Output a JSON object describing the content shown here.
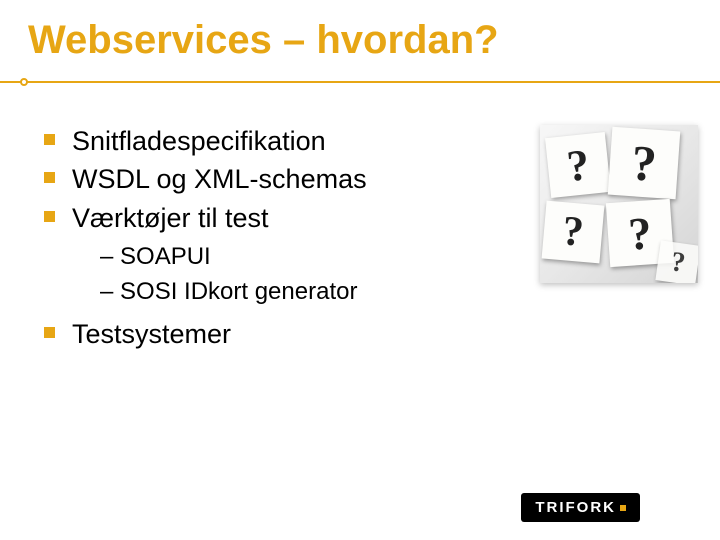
{
  "title": "Webservices – hvordan?",
  "bullets": {
    "b1": "Snitfladespecifikation",
    "b2": "WSDL og XML-schemas",
    "b3": "Værktøjer til test",
    "b3_sub": {
      "s1": "SOAPUI",
      "s2": "SOSI IDkort generator"
    },
    "b4": "Testsystemer"
  },
  "logo_text": "TRIFORK",
  "decor_char": "?"
}
